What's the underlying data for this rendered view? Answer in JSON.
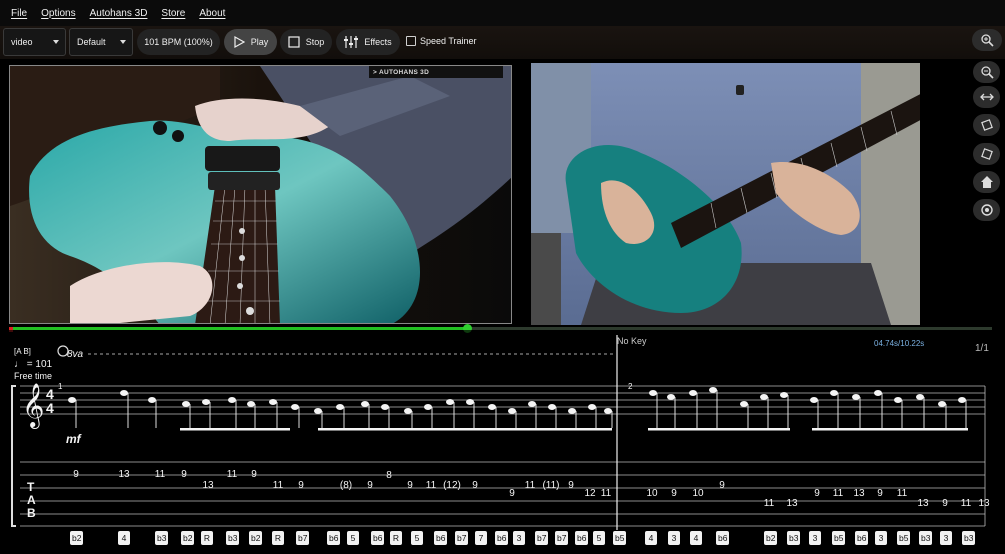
{
  "menu": [
    "File",
    "Options",
    "Autohans 3D",
    "Store",
    "About"
  ],
  "toolbar": {
    "view_select": "video",
    "preset_select": "Default",
    "tempo": "101 BPM (100%)",
    "play": "Play",
    "stop": "Stop",
    "effects": "Effects",
    "speed_trainer": "Speed Trainer"
  },
  "video": {
    "badge_3d": "> AUTOHANS 3D"
  },
  "playback": {
    "progress": 0.466,
    "time": "04.74s/10.22s",
    "page": "1/1"
  },
  "score": {
    "key_label": "No Key",
    "tempo_mark": "♩ = 101",
    "time_feel": "Free time",
    "ottava": "8va",
    "dynamic": "mf",
    "measure_1": "1",
    "measure_2": "2",
    "tab_line1_a": [
      "9",
      "13",
      "11",
      "9",
      "11",
      "9"
    ],
    "tab_line2_a": [
      "13",
      "11",
      "9",
      "(8)",
      "9"
    ],
    "tab_b": [
      "8",
      "9",
      "11",
      "(12)",
      "9",
      "9",
      "11",
      "(11)",
      "9",
      "12",
      "11"
    ],
    "tab_m2": [
      "10",
      "9",
      "10",
      "9",
      "11",
      "13",
      "9",
      "11",
      "13",
      "9",
      "11",
      "13",
      "9",
      "11",
      "13"
    ],
    "degrees": [
      "b2",
      "4",
      "b3",
      "b2",
      "R",
      "b3",
      "b2",
      "R",
      "b7",
      "b6",
      "5",
      "b6",
      "R",
      "5",
      "b6",
      "b7",
      "7",
      "b6",
      "3",
      "b7",
      "b7",
      "b6",
      "5",
      "b5",
      "4",
      "3",
      "4",
      "b6",
      "b2",
      "b3",
      "3",
      "b5",
      "b6",
      "3",
      "b5",
      "b3",
      "3",
      "b3"
    ]
  },
  "icons": {
    "zoom_in": "zoom-in-icon",
    "zoom_out": "zoom-out-icon",
    "fit_width": "fit-width-icon",
    "rotate_left": "rotate-left-icon",
    "rotate_right": "rotate-right-icon",
    "home": "home-icon",
    "reset": "reset-view-icon"
  },
  "colors": {
    "progress": "#22c022",
    "guitar": "#1a8a8a",
    "background": "#000000"
  }
}
